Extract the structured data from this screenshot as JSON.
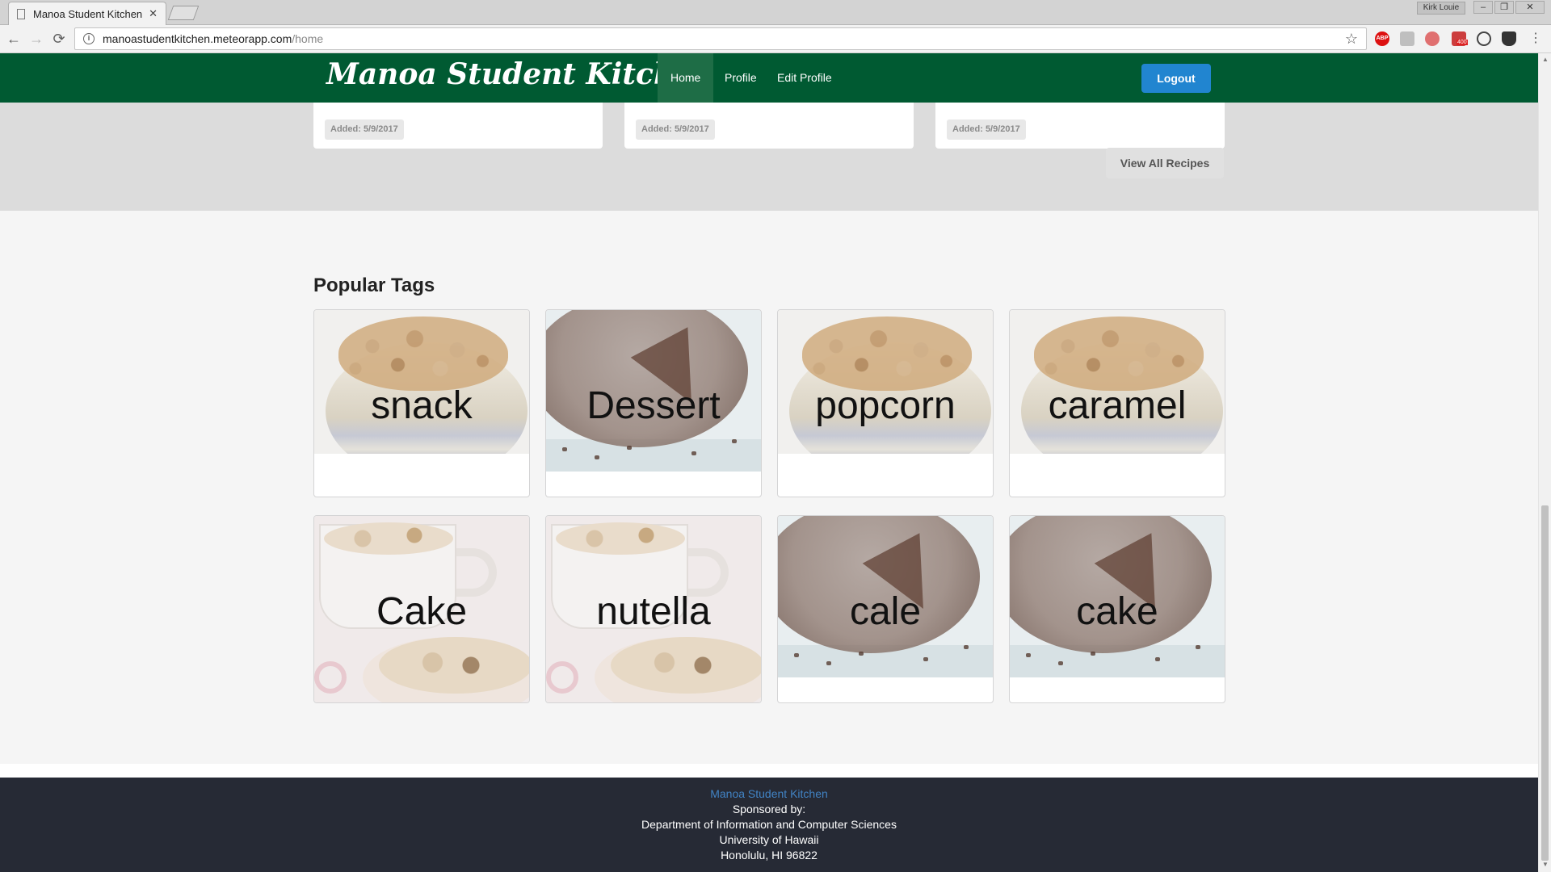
{
  "browser": {
    "tab_title": "Manoa Student Kitchen",
    "tab_close": "✕",
    "user_name": "Kirk Louie",
    "url_host": "manoastudentkitchen.meteorapp.com",
    "url_path": "/home",
    "extension_badge": "400"
  },
  "navbar": {
    "brand": "Manoa Student Kitchen",
    "items": [
      {
        "label": "Home",
        "active": true
      },
      {
        "label": "Profile",
        "active": false
      },
      {
        "label": "Edit Profile",
        "active": false
      }
    ],
    "logout_label": "Logout"
  },
  "recipes": {
    "cards": [
      {
        "added": "Added: 5/9/2017"
      },
      {
        "added": "Added: 5/9/2017"
      },
      {
        "added": "Added: 5/9/2017"
      }
    ],
    "view_all_label": "View All Recipes"
  },
  "popular_tags": {
    "title": "Popular Tags",
    "tags": [
      {
        "label": "snack",
        "image": "popcorn-bowl"
      },
      {
        "label": "Dessert",
        "image": "chocolate-cake"
      },
      {
        "label": "popcorn",
        "image": "popcorn-bowl"
      },
      {
        "label": "caramel",
        "image": "popcorn-bowl"
      },
      {
        "label": "Cake",
        "image": "mug-cake"
      },
      {
        "label": "nutella",
        "image": "mug-cake"
      },
      {
        "label": "cale",
        "image": "chocolate-cake"
      },
      {
        "label": "cake",
        "image": "chocolate-cake"
      }
    ]
  },
  "footer": {
    "site_link": "Manoa Student Kitchen",
    "sponsored": "Sponsored by:",
    "department": "Department of Information and Computer Sciences",
    "university": "University of Hawaii",
    "address": "Honolulu, HI 96822"
  },
  "colors": {
    "nav_green": "#005a32",
    "nav_active": "#1e6d46",
    "logout_blue": "#2185d0",
    "footer_bg": "#262a35",
    "footer_link": "#4183c4"
  }
}
